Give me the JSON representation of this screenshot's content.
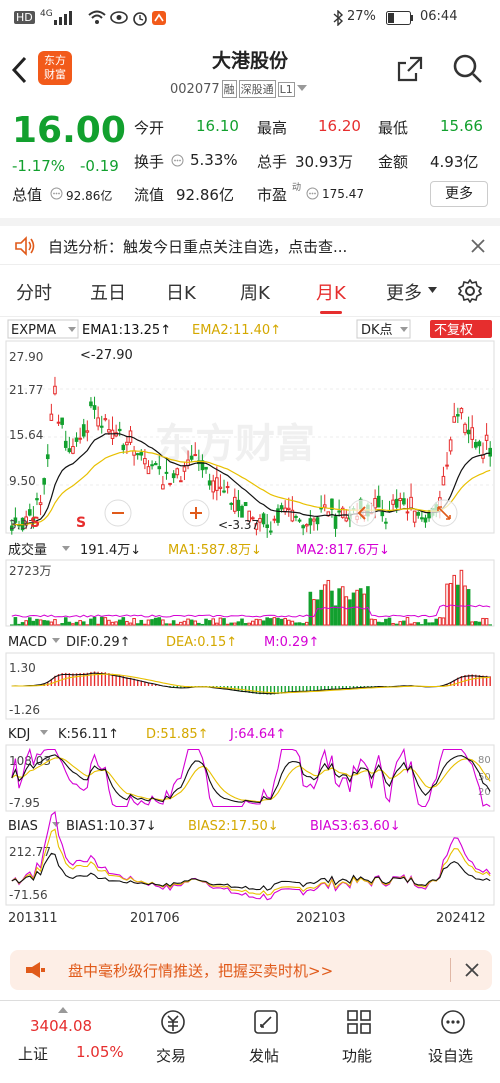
{
  "status_bar": {
    "carrier": "HD",
    "signal": "4G",
    "battery": "27%",
    "time": "06:44"
  },
  "header": {
    "title": "大港股份",
    "code": "002077",
    "tags": [
      "融",
      "深股通",
      "L1"
    ],
    "logo_text": [
      "东方",
      "财富"
    ]
  },
  "quote": {
    "price": "16.00",
    "change_pct": "-1.17%",
    "change": "-0.19",
    "open_label": "今开",
    "open": "16.10",
    "high_label": "最高",
    "high": "16.20",
    "low_label": "最低",
    "low": "15.66",
    "turnover_label": "换手",
    "turnover": "5.33%",
    "volume_label": "总手",
    "volume": "30.93万",
    "amount_label": "金额",
    "amount": "4.93亿",
    "mktcap_label": "总值",
    "mktcap": "92.86亿",
    "float_label": "流值",
    "float": "92.86亿",
    "pe_label": "市盈",
    "pe_sup": "动",
    "pe": "175.47",
    "more_button": "更多"
  },
  "banner": {
    "text": "自选分析：触发今日重点关注自选，点击查..."
  },
  "tabs": [
    "分时",
    "五日",
    "日K",
    "周K",
    "月K",
    "更多"
  ],
  "active_tab": "月K",
  "main_indicator": {
    "name": "EXPMA",
    "ema1": "EMA1:13.25↑",
    "ema2": "EMA2:11.40↑",
    "dk": "DK点",
    "restore": "不复权",
    "y_labels": [
      "27.90",
      "21.77",
      "15.64",
      "9.50",
      "3.37"
    ],
    "max_label": "<-27.90",
    "min_label": "<-3.37",
    "markers": [
      "S",
      "S"
    ]
  },
  "volume_indicator": {
    "name": "成交量",
    "value": "191.4万↓",
    "ma1": "MA1:587.8万↓",
    "ma2": "MA2:817.6万↓",
    "y_max": "2723万"
  },
  "macd_indicator": {
    "name": "MACD",
    "dif": "DIF:0.29↑",
    "dea": "DEA:0.15↑",
    "m": "M:0.29↑",
    "y_max": "1.30",
    "y_min": "-1.26"
  },
  "kdj_indicator": {
    "name": "KDJ",
    "k": "K:56.11↑",
    "d": "D:51.85↑",
    "j": "J:64.64↑",
    "y_max": "108.03",
    "y_min": "-7.95",
    "right_labels": [
      "80",
      "50",
      "20"
    ]
  },
  "bias_indicator": {
    "name": "BIAS",
    "b1": "BIAS1:10.37↓",
    "b2": "BIAS2:17.50↓",
    "b3": "BIAS3:63.60↓",
    "y_max": "212.77",
    "y_min": "-71.56"
  },
  "x_axis": [
    "201311",
    "201706",
    "202103",
    "202412"
  ],
  "promo": {
    "text": "盘中毫秒级行情推送，把握买卖时机>>"
  },
  "bottom_nav": {
    "index_value": "3404.08",
    "index_name": "上证",
    "index_change": "1.05%",
    "items": [
      "交易",
      "发帖",
      "功能",
      "设自选"
    ]
  },
  "watermark": "东方财富",
  "colors": {
    "up": "#e62e2e",
    "down": "#12a02e",
    "ema1": "#111111",
    "ema2": "#e8c000",
    "ma2": "#d400d4"
  }
}
